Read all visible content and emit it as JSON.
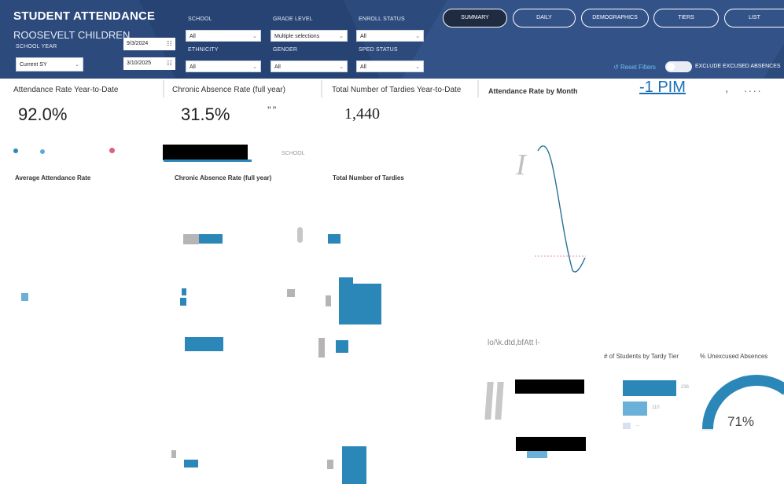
{
  "header": {
    "title": "STUDENT ATTENDANCE",
    "subtitle": "ROOSEVELT CHILDREN",
    "school_year_label": "SCHOOL YEAR",
    "school_year_value": "Current SY",
    "date_start": "9/3/2024",
    "date_end": "3/10/2025",
    "filters": {
      "school_label": "SCHOOL",
      "school_value": "All",
      "ethnicity_label": "ETHNICITY",
      "ethnicity_value": "All",
      "grade_label": "GRADE LEVEL",
      "grade_value": "Multiple selections",
      "gender_label": "GENDER",
      "gender_value": "All",
      "enroll_label": "ENROLL STATUS",
      "enroll_value": "All",
      "sped_label": "SPED STATUS",
      "sped_value": "All"
    },
    "tabs": [
      "SUMMARY",
      "DAILY",
      "DEMOGRAPHICS",
      "TIERS",
      "LIST"
    ],
    "reset_label": "Reset Filters",
    "exclude_label": "EXCLUDE EXCUSED ABSENCES"
  },
  "kpis": {
    "attendance_label": "Attendance Rate Year-to-Date",
    "attendance_value": "92.0%",
    "chronic_label": "Chronic Absence Rate (full year)",
    "chronic_value": "31.5%",
    "chronic_mark": "””",
    "tardies_label": "Total Number of Tardies Year-to-Date",
    "tardies_value": "1,440",
    "month_label": "Attendance Rate by Month"
  },
  "top_right": {
    "link": "-1 PIM",
    "sep": ",",
    "ellipsis": "...."
  },
  "school_legend": "SCHOOL",
  "section_titles": {
    "avg": "Average Attendance Rate",
    "chronic": "Chronic Absence Rate (full year)",
    "tardies": "Total Number of Tardies"
  },
  "chart_glyph": "I",
  "lower_text": "lo/\\k.dtd,bfAtt l-",
  "tardy_tier_label": "# of Students by Tardy Tier",
  "unexcused_label": "% Unexcused Absences",
  "tardy_bar_labels": [
    "236",
    "110",
    "..."
  ],
  "gauge": {
    "value": 71,
    "label": "71%"
  },
  "colors": {
    "header": "#2c4a7c",
    "accent": "#2a87b8",
    "dot1": "#2a87b8",
    "dot2": "#5aaad8",
    "dot3": "#e0607a"
  }
}
